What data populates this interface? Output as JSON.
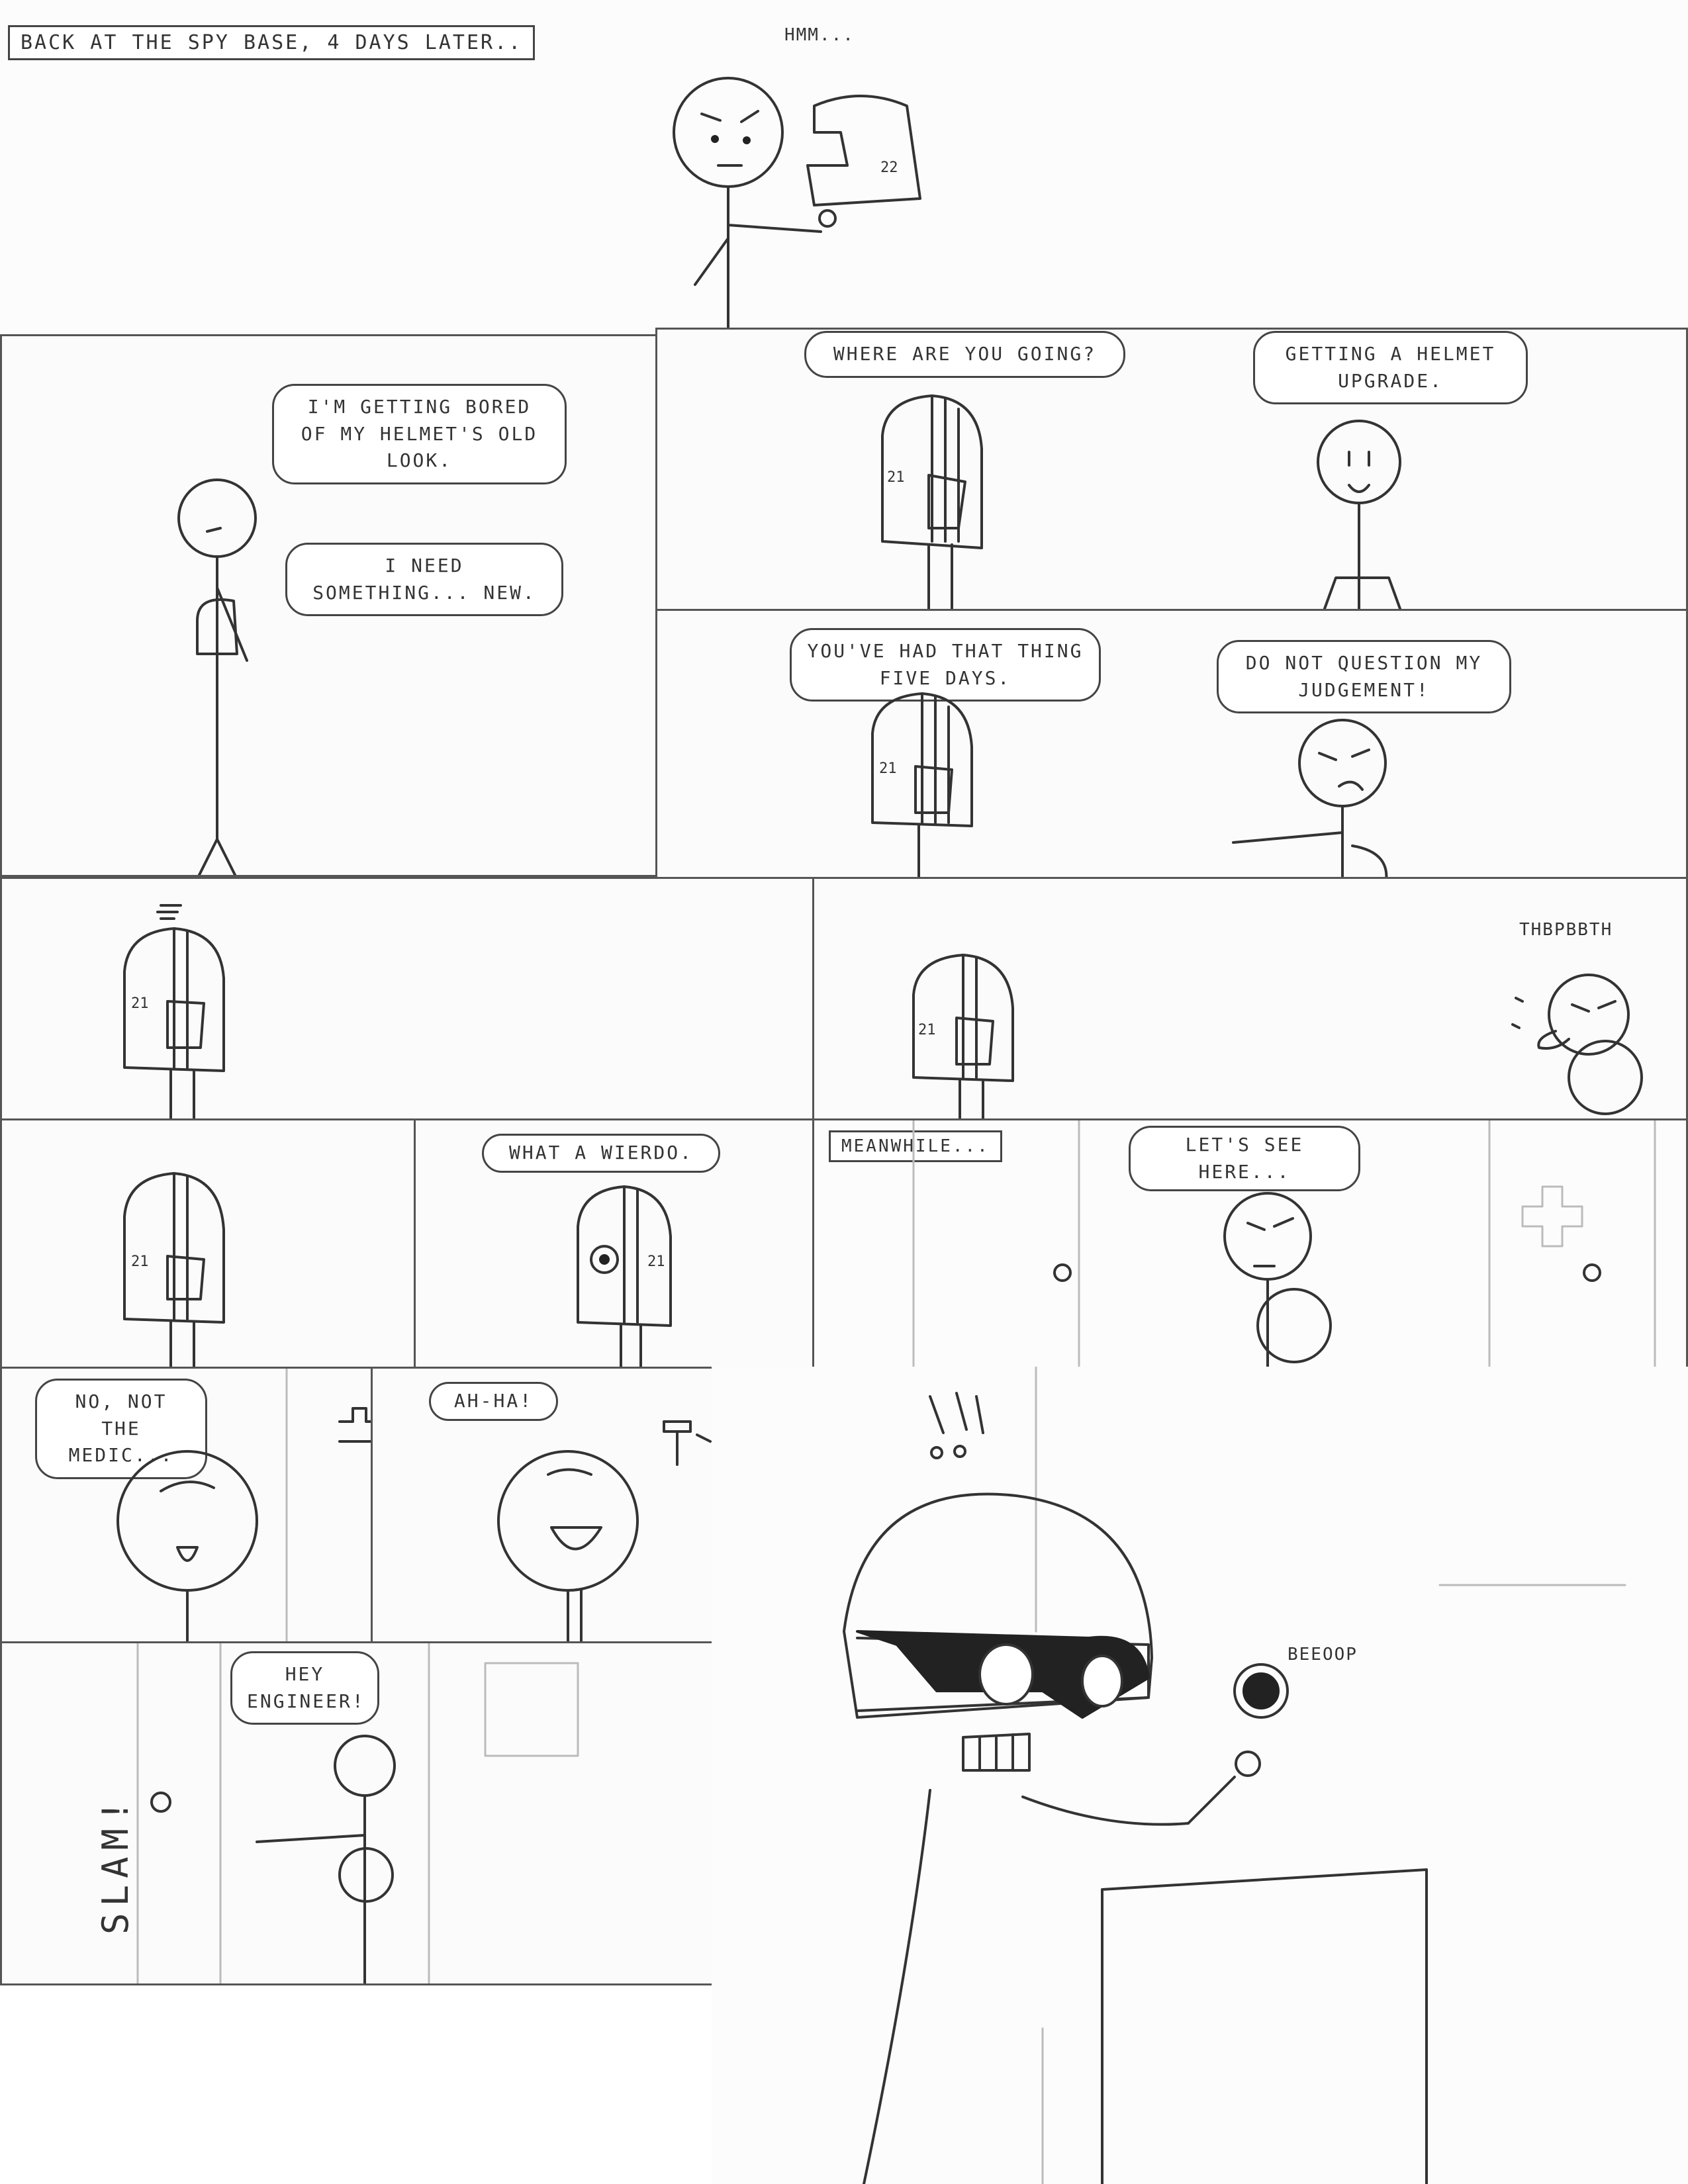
{
  "row1": {
    "caption": "BACK AT THE SPY BASE, 4 DAYS LATER..",
    "sfx_hmm": "HMM...",
    "helmet_number": "22"
  },
  "row2": {
    "left": {
      "bubble_1": "I'M GETTING BORED OF MY HELMET'S OLD LOOK.",
      "bubble_2": "I NEED SOMETHING... NEW."
    },
    "right_top": {
      "bubble_left": "WHERE ARE YOU GOING?",
      "bubble_right": "GETTING A HELMET UPGRADE.",
      "helmet_number": "21"
    },
    "right_bottom": {
      "bubble_left": "YOU'VE HAD THAT THING FIVE DAYS.",
      "bubble_right": "DO NOT QUESTION MY JUDGEMENT!",
      "helmet_number": "21"
    }
  },
  "row3": {
    "left": {
      "helmet_number": "21"
    },
    "right": {
      "sfx": "THBPBBTH",
      "helmet_number": "21"
    }
  },
  "row4": {
    "p1": {
      "helmet_number": "21"
    },
    "p2": {
      "bubble": "WHAT A WIERDO.",
      "helmet_number": "21"
    },
    "p3": {
      "caption": "MEANWHILE...",
      "bubble": "LET'S SEE HERE..."
    }
  },
  "row5": {
    "p1": {
      "bubble": "NO, NOT THE MEDIC..."
    },
    "p2": {
      "bubble": "AH-HA!"
    },
    "big": {
      "sfx": "BEEOOP"
    }
  },
  "row6": {
    "bubble": "HEY ENGINEER!",
    "sfx": "SLAM!"
  }
}
